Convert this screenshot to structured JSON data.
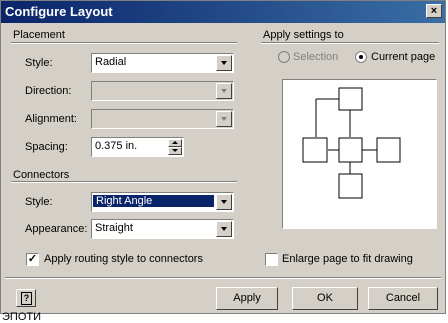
{
  "title": "Configure Layout",
  "placement": {
    "header": "Placement",
    "style_label": "Style:",
    "style_value": "Radial",
    "direction_label": "Direction:",
    "direction_value": "",
    "alignment_label": "Alignment:",
    "alignment_value": "",
    "spacing_label": "Spacing:",
    "spacing_value": "0.375 in."
  },
  "connectors": {
    "header": "Connectors",
    "style_label": "Style:",
    "style_value": "Right Angle",
    "appearance_label": "Appearance:",
    "appearance_value": "Straight",
    "routing_checkbox_label": "Apply routing style to connectors",
    "routing_checked": true
  },
  "apply_settings": {
    "header": "Apply settings to",
    "selection_label": "Selection",
    "current_page_label": "Current page",
    "selected": "Current page"
  },
  "enlarge_checkbox_label": "Enlarge page to fit drawing",
  "enlarge_checked": false,
  "buttons": {
    "apply": "Apply",
    "ok": "OK",
    "cancel": "Cancel"
  },
  "background_text": "ЭПОТИ"
}
